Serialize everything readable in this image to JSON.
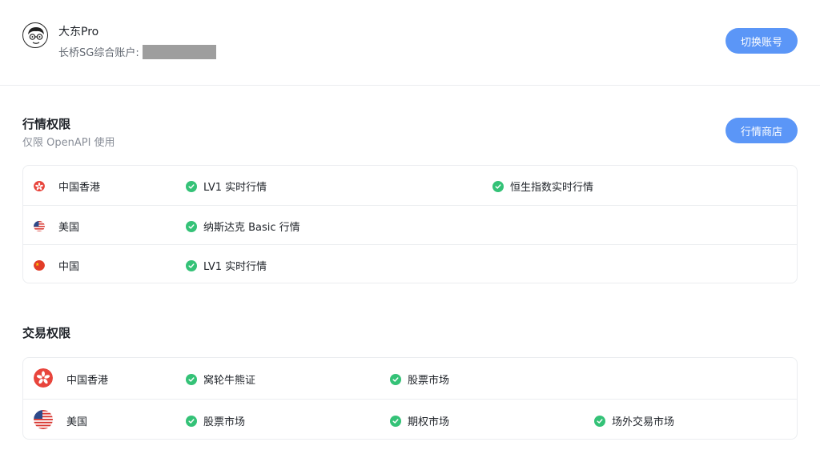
{
  "header": {
    "user_name": "大东Pro",
    "account_label": "长桥SG综合账户:",
    "switch_button": "切换账号",
    "avatar_icon": "cartoon-avatar-icon"
  },
  "quote_section": {
    "title": "行情权限",
    "subtitle": "仅限 OpenAPI 使用",
    "store_button": "行情商店",
    "rows": [
      {
        "region": "中国香港",
        "flag": "hk-flag-icon",
        "permissions": [
          "LV1 实时行情",
          "恒生指数实时行情"
        ]
      },
      {
        "region": "美国",
        "flag": "us-flag-icon",
        "permissions": [
          "纳斯达克 Basic 行情"
        ]
      },
      {
        "region": "中国",
        "flag": "cn-flag-icon",
        "permissions": [
          "LV1 实时行情"
        ]
      }
    ]
  },
  "trade_section": {
    "title": "交易权限",
    "rows": [
      {
        "region": "中国香港",
        "flag": "hk-flag-icon",
        "permissions": [
          "窝轮牛熊证",
          "股票市场"
        ]
      },
      {
        "region": "美国",
        "flag": "us-flag-icon",
        "permissions": [
          "股票市场",
          "期权市场",
          "场外交易市场"
        ]
      }
    ]
  },
  "colors": {
    "primary": "#5b96f7",
    "check": "#34c277",
    "border": "#ebedf0",
    "hk_red": "#e8453c"
  }
}
